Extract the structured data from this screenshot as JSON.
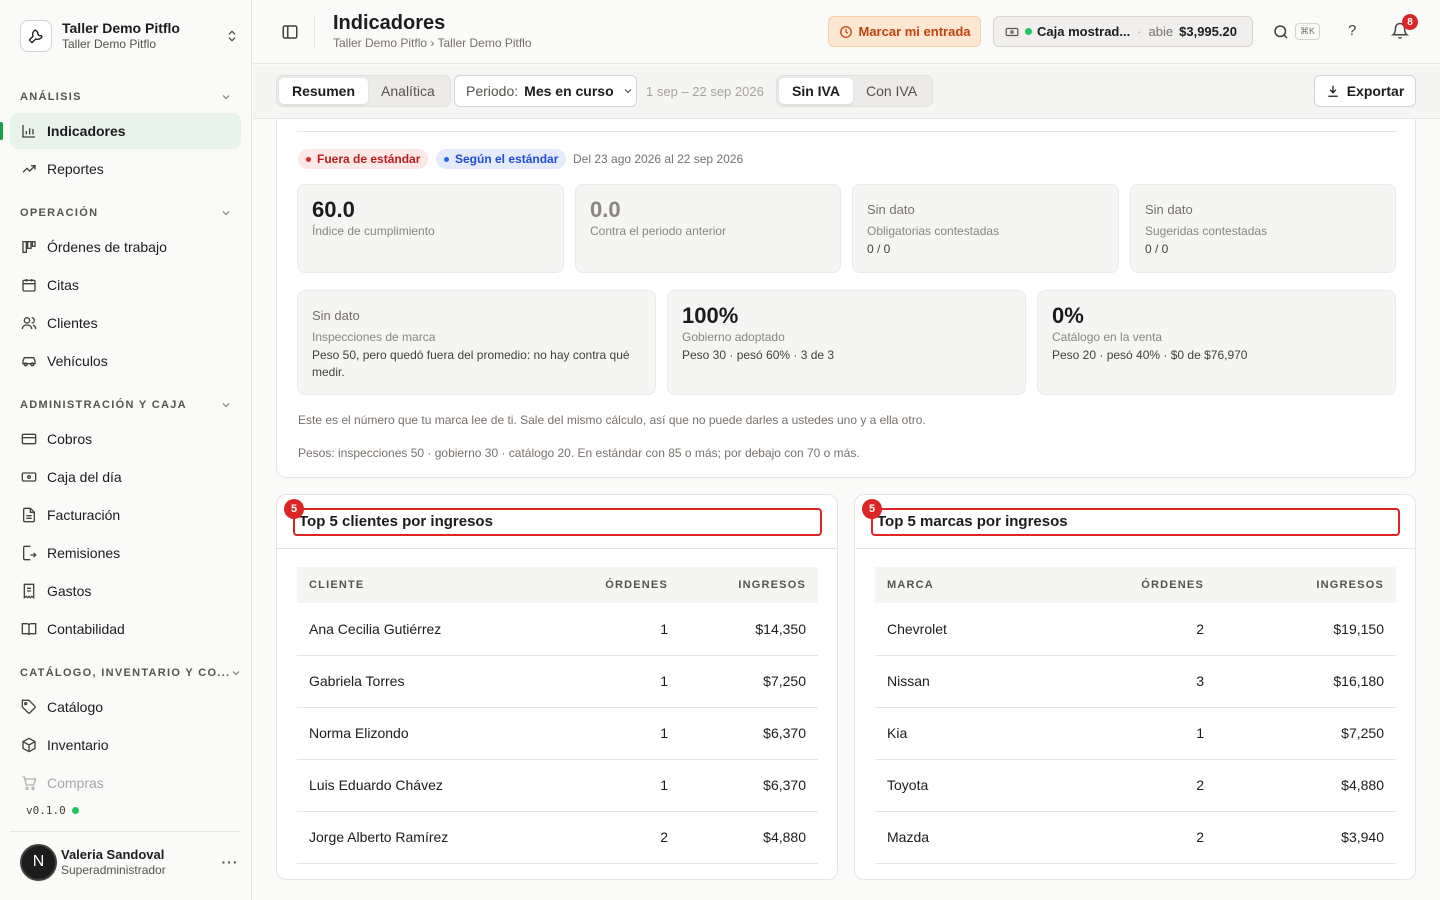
{
  "sidebar": {
    "workspace": {
      "name": "Taller Demo Pitflo",
      "subtitle": "Taller Demo Pitflo"
    },
    "sections": [
      {
        "title": "ANÁLISIS",
        "items": [
          "Indicadores",
          "Reportes"
        ]
      },
      {
        "title": "OPERACIÓN",
        "items": [
          "Órdenes de trabajo",
          "Citas",
          "Clientes",
          "Vehículos"
        ]
      },
      {
        "title": "ADMINISTRACIÓN Y CAJA",
        "items": [
          "Cobros",
          "Caja del día",
          "Facturación",
          "Remisiones",
          "Gastos",
          "Contabilidad"
        ]
      },
      {
        "title": "CATÁLOGO, INVENTARIO Y CO...",
        "items": [
          "Catálogo",
          "Inventario",
          "Compras"
        ]
      }
    ],
    "active_item": "Indicadores",
    "version": "v0.1.0",
    "user": {
      "initial": "N",
      "name": "Valeria Sandoval",
      "role": "Superadministrador"
    }
  },
  "header": {
    "title": "Indicadores",
    "breadcrumb": "Taller Demo Pitflo › Taller Demo Pitflo",
    "entrada_button": "Marcar mi entrada",
    "caja": {
      "name": "Caja mostrad...",
      "separator": "·",
      "state": "abie",
      "amount": "$3,995.20"
    },
    "shortcut": "⌘K",
    "help": "?",
    "notifications": "8"
  },
  "toolbar": {
    "view_tabs": [
      "Resumen",
      "Analítica"
    ],
    "active_view": "Resumen",
    "periodo_label": "Periodo:",
    "periodo_value": "Mes en curso",
    "range": "1 sep – 22 sep 2026",
    "tax_tabs": [
      "Sin IVA",
      "Con IVA"
    ],
    "active_tax": "Sin IVA",
    "export": "Exportar"
  },
  "compliance": {
    "badge_out": "Fuera de estándar",
    "badge_std": "Según el estándar",
    "date_range": "Del 23 ago 2026 al 22 sep 2026",
    "row1": [
      {
        "value": "60.0",
        "label": "Índice de cumplimiento"
      },
      {
        "value": "0.0",
        "label": "Contra el periodo anterior"
      },
      {
        "value": "Sin dato",
        "label": "Obligatorias contestadas",
        "sub": "0 / 0"
      },
      {
        "value": "Sin dato",
        "label": "Sugeridas contestadas",
        "sub": "0 / 0"
      }
    ],
    "row2": [
      {
        "value": "Sin dato",
        "label": "Inspecciones de marca",
        "sub": "Peso 50, pero quedó fuera del promedio: no hay contra qué medir."
      },
      {
        "value": "100%",
        "label": "Gobierno adoptado",
        "sub": "Peso 30 · pesó 60% · 3 de 3"
      },
      {
        "value": "0%",
        "label": "Catálogo en la venta",
        "sub": "Peso 20 · pesó 40% · $0 de $76,970"
      }
    ],
    "note1": "Este es el número que tu marca lee de ti. Sale del mismo cálculo, así que no puede darles a ustedes uno y a ella otro.",
    "note2": "Pesos: inspecciones 50 · gobierno 30 · catálogo 20. En estándar con 85 o más; por debajo con 70 o más."
  },
  "top_clients": {
    "badge": "5",
    "title": "Top 5 clientes por ingresos",
    "columns": [
      "CLIENTE",
      "ÓRDENES",
      "INGRESOS"
    ],
    "rows": [
      [
        "Ana Cecilia Gutiérrez",
        "1",
        "$14,350"
      ],
      [
        "Gabriela Torres",
        "1",
        "$7,250"
      ],
      [
        "Norma Elizondo",
        "1",
        "$6,370"
      ],
      [
        "Luis Eduardo Chávez",
        "1",
        "$6,370"
      ],
      [
        "Jorge Alberto Ramírez",
        "2",
        "$4,880"
      ]
    ]
  },
  "top_brands": {
    "badge": "5",
    "title": "Top 5 marcas por ingresos",
    "columns": [
      "MARCA",
      "ÓRDENES",
      "INGRESOS"
    ],
    "rows": [
      [
        "Chevrolet",
        "2",
        "$19,150"
      ],
      [
        "Nissan",
        "3",
        "$16,180"
      ],
      [
        "Kia",
        "1",
        "$7,250"
      ],
      [
        "Toyota",
        "2",
        "$4,880"
      ],
      [
        "Mazda",
        "2",
        "$3,940"
      ]
    ]
  }
}
